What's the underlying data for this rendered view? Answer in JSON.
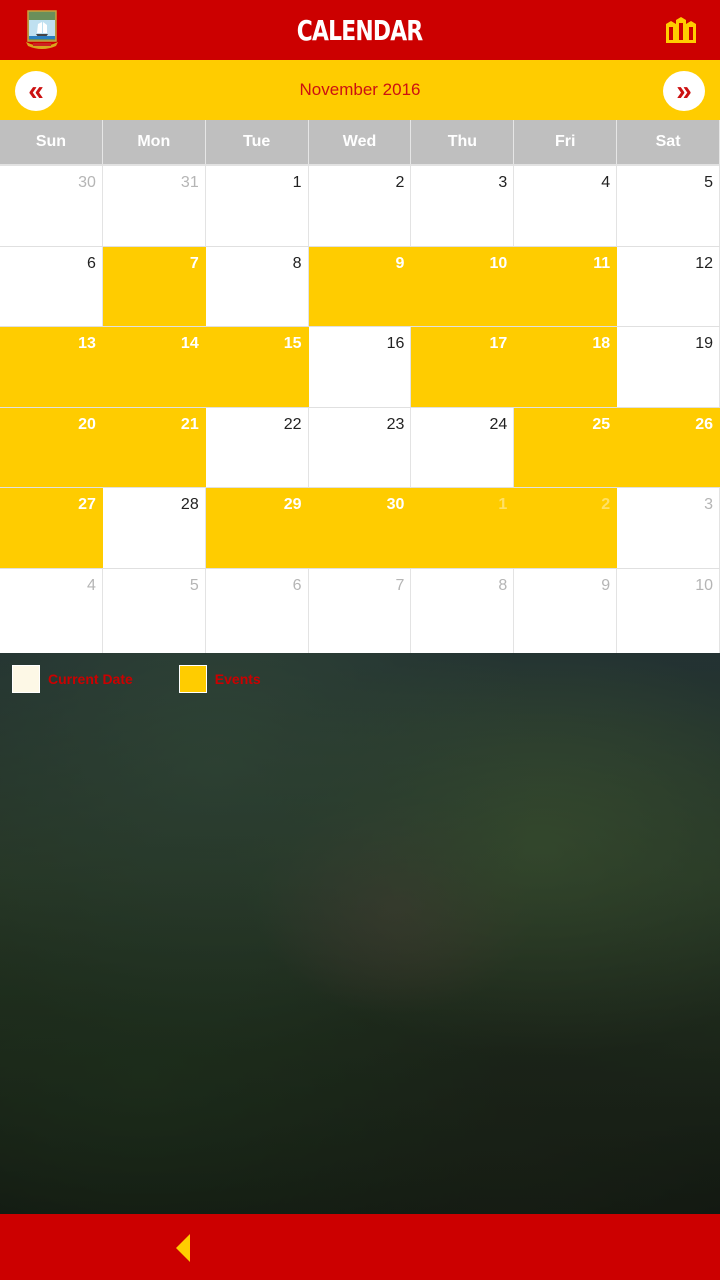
{
  "header": {
    "title": "CALENDAR",
    "logo_icon": "coat-of-arms-logo",
    "menu_icon": "buildings-icon"
  },
  "month_nav": {
    "label": "November 2016",
    "prev_glyph": "«",
    "next_glyph": "»"
  },
  "calendar": {
    "weekdays": [
      "Sun",
      "Mon",
      "Tue",
      "Wed",
      "Thu",
      "Fri",
      "Sat"
    ],
    "weeks": [
      [
        {
          "d": "30",
          "other": true,
          "event": false
        },
        {
          "d": "31",
          "other": true,
          "event": false
        },
        {
          "d": "1",
          "other": false,
          "event": false
        },
        {
          "d": "2",
          "other": false,
          "event": false
        },
        {
          "d": "3",
          "other": false,
          "event": false
        },
        {
          "d": "4",
          "other": false,
          "event": false
        },
        {
          "d": "5",
          "other": false,
          "event": false
        }
      ],
      [
        {
          "d": "6",
          "other": false,
          "event": false
        },
        {
          "d": "7",
          "other": false,
          "event": true
        },
        {
          "d": "8",
          "other": false,
          "event": false
        },
        {
          "d": "9",
          "other": false,
          "event": true
        },
        {
          "d": "10",
          "other": false,
          "event": true
        },
        {
          "d": "11",
          "other": false,
          "event": true
        },
        {
          "d": "12",
          "other": false,
          "event": false
        }
      ],
      [
        {
          "d": "13",
          "other": false,
          "event": true
        },
        {
          "d": "14",
          "other": false,
          "event": true
        },
        {
          "d": "15",
          "other": false,
          "event": true
        },
        {
          "d": "16",
          "other": false,
          "event": false
        },
        {
          "d": "17",
          "other": false,
          "event": true
        },
        {
          "d": "18",
          "other": false,
          "event": true
        },
        {
          "d": "19",
          "other": false,
          "event": false
        }
      ],
      [
        {
          "d": "20",
          "other": false,
          "event": true
        },
        {
          "d": "21",
          "other": false,
          "event": true
        },
        {
          "d": "22",
          "other": false,
          "event": false
        },
        {
          "d": "23",
          "other": false,
          "event": false
        },
        {
          "d": "24",
          "other": false,
          "event": false
        },
        {
          "d": "25",
          "other": false,
          "event": true
        },
        {
          "d": "26",
          "other": false,
          "event": true
        }
      ],
      [
        {
          "d": "27",
          "other": false,
          "event": true
        },
        {
          "d": "28",
          "other": false,
          "event": false
        },
        {
          "d": "29",
          "other": false,
          "event": true
        },
        {
          "d": "30",
          "other": false,
          "event": true
        },
        {
          "d": "1",
          "other": true,
          "event": true
        },
        {
          "d": "2",
          "other": true,
          "event": true
        },
        {
          "d": "3",
          "other": true,
          "event": false
        }
      ],
      [
        {
          "d": "4",
          "other": true,
          "event": false
        },
        {
          "d": "5",
          "other": true,
          "event": false
        },
        {
          "d": "6",
          "other": true,
          "event": false
        },
        {
          "d": "7",
          "other": true,
          "event": false
        },
        {
          "d": "8",
          "other": true,
          "event": false
        },
        {
          "d": "9",
          "other": true,
          "event": false
        },
        {
          "d": "10",
          "other": true,
          "event": false
        }
      ]
    ]
  },
  "legend": [
    {
      "label": "Current Date",
      "color": "#fdf8e6"
    },
    {
      "label": "Events",
      "color": "#ffcc00"
    }
  ],
  "footer": {
    "back_icon": "back-arrow-icon"
  },
  "colors": {
    "primary_red": "#cc0000",
    "accent_yellow": "#ffcc00"
  }
}
